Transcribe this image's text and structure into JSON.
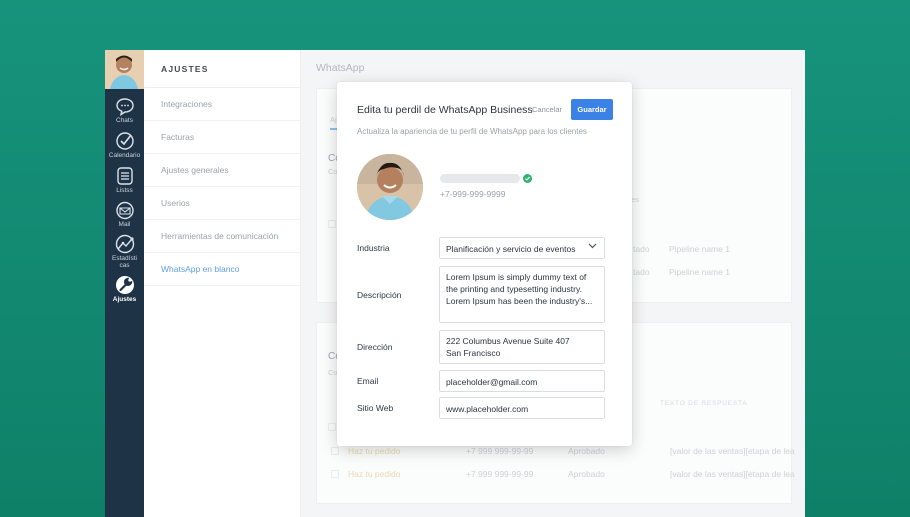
{
  "rail": {
    "items": [
      {
        "label": "Chats",
        "icon": "chat-icon"
      },
      {
        "label": "Calendario",
        "icon": "check-circle-icon"
      },
      {
        "label": "Listss",
        "icon": "list-icon"
      },
      {
        "label": "Mail",
        "icon": "mail-icon"
      },
      {
        "label": "Estadísti cas",
        "icon": "stats-icon"
      },
      {
        "label": "Ajustes",
        "icon": "wrench-icon"
      }
    ]
  },
  "settings": {
    "heading": "AJUSTES",
    "items": [
      "Integraciones",
      "Facturas",
      "Ajustes generales",
      "Userios",
      "Herramientas de comunicación",
      "WhatsApp en blanco"
    ]
  },
  "main": {
    "title": "WhatsApp",
    "bg": {
      "tab_stub": "Aj",
      "sec1_title": "Co",
      "sec1_sub": "Co",
      "sec1_col": "es",
      "sec1_rows": [
        {
          "status": "tado",
          "pipeline": "Pipeline name 1"
        },
        {
          "status": "tado",
          "pipeline": "Pipeline name 1"
        }
      ],
      "sec2_title": "Co",
      "sec2_sub": "Co",
      "sec2_header": "TEXTO DE RESPUESTA",
      "rows": [
        {
          "name": "Haz tu pedido",
          "phone": "+7 999 999-99-99",
          "status": "Aprobado",
          "text": "[valor de las ventas][etapa de lea"
        },
        {
          "name": "Haz tu pedido",
          "phone": "+7 999 999-99-99",
          "status": "Aprobado",
          "text": "[valor de las ventas][etapa de lea"
        }
      ]
    }
  },
  "modal": {
    "title": "Edita tu perdil de WhatsApp Business",
    "cancel": "Cancelar",
    "save": "Guardar",
    "subtitle": "Actualiza la apariencia de tu perfil de WhatsApp para los clientes",
    "phone": "+7-999-999-9999",
    "labels": {
      "industry": "Industria",
      "description": "Descripción",
      "address": "Dirección",
      "email": "Email",
      "website": "Sitio Web"
    },
    "industry_value": "Planificación y servicio de eventos",
    "description_lines": [
      "Lorem Ipsum is simply dummy text of",
      "the printing and typesetting industry.",
      "Lorem Ipsum has been the industry's..."
    ],
    "address_lines": [
      "222 Columbus Avenue Suite 407",
      "San Francisco"
    ],
    "email_value": "placeholder@gmail.com",
    "website_value": "www.placeholder.com",
    "colors": {
      "accent": "#3c82e6",
      "verified": "#2fb36f",
      "rail": "#1f3347",
      "background": "#17937c"
    }
  }
}
